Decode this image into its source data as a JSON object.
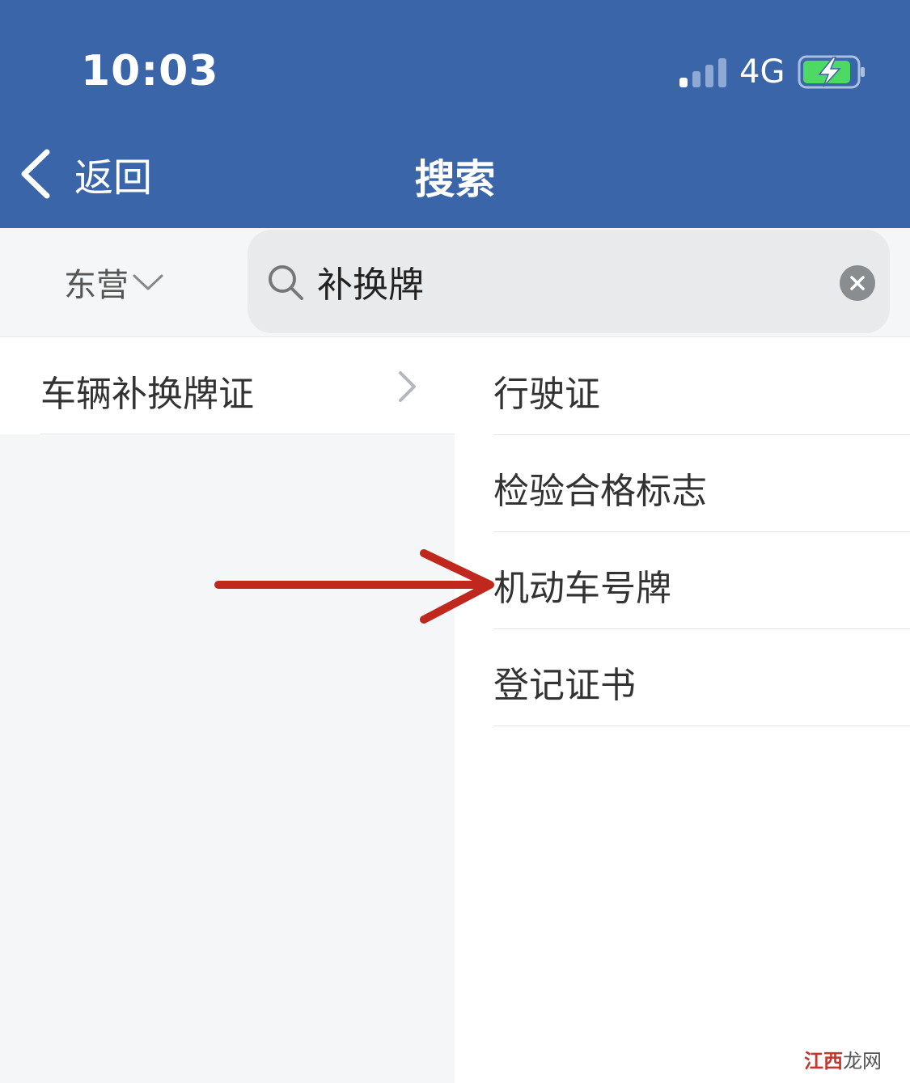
{
  "status_bar": {
    "time": "10:03",
    "network": "4G",
    "signal_icon": "signal-bars-icon",
    "battery_icon": "battery-charging-icon",
    "battery_color": "#4cd964"
  },
  "nav": {
    "back_label": "返回",
    "title": "搜索",
    "color": "#3a65a8"
  },
  "search": {
    "city": "东营",
    "query": "补换牌"
  },
  "left_list": {
    "items": [
      {
        "label": "车辆补换牌证"
      }
    ]
  },
  "right_list": {
    "items": [
      {
        "label": "行驶证"
      },
      {
        "label": "检验合格标志"
      },
      {
        "label": "机动车号牌"
      },
      {
        "label": "登记证书"
      }
    ]
  },
  "annotation": {
    "icon": "red-arrow-icon",
    "color": "#c0281e"
  },
  "watermark": {
    "accent": "江西",
    "rest": "龙网"
  }
}
